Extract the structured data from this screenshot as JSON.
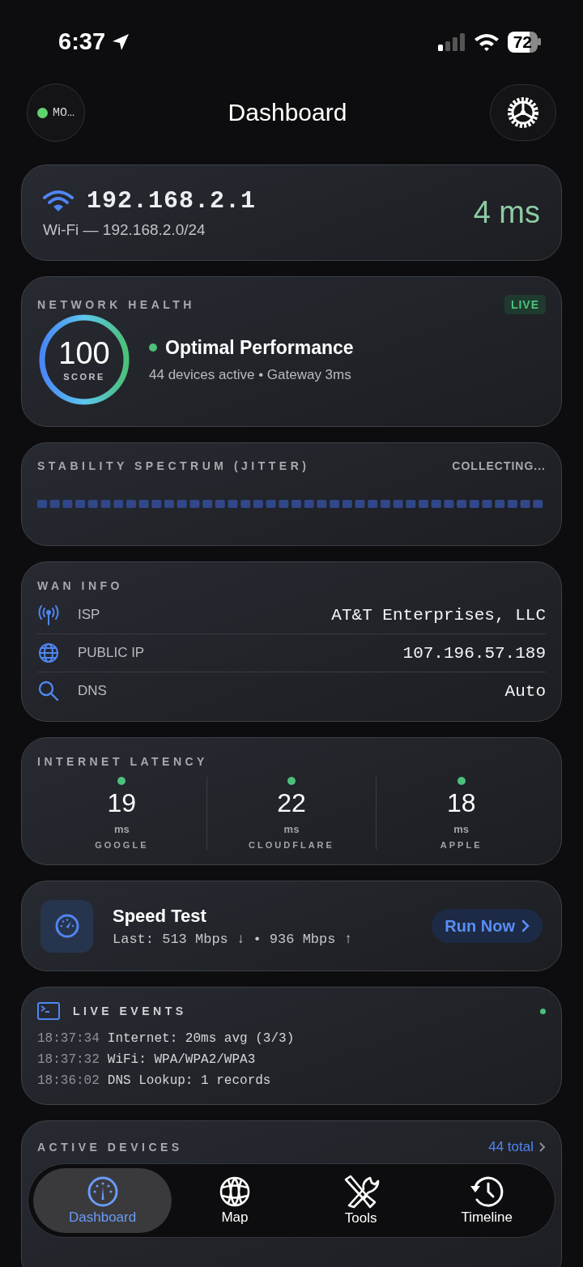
{
  "status_bar": {
    "time": "6:37",
    "battery": "72"
  },
  "header": {
    "mode_label": "MO…",
    "title": "Dashboard"
  },
  "connection": {
    "gateway": "192.168.2.1",
    "subtitle": "Wi-Fi — 192.168.2.0/24",
    "latency": "4 ms"
  },
  "network_health": {
    "title": "NETWORK HEALTH",
    "badge": "LIVE",
    "score": "100",
    "score_label": "SCORE",
    "level": 1,
    "status": "Optimal Performance",
    "detail": "44 devices active • Gateway 3ms"
  },
  "stability": {
    "title": "STABILITY SPECTRUM (JITTER)",
    "status": "COLLECTING..."
  },
  "wan_info": {
    "title": "WAN INFO",
    "rows": [
      {
        "kind": "antenna",
        "label": "ISP",
        "value": "AT&T Enterprises, LLC"
      },
      {
        "kind": "globe",
        "label": "PUBLIC IP",
        "value": "107.196.57.189"
      },
      {
        "kind": "search",
        "label": "DNS",
        "value": "Auto"
      }
    ]
  },
  "latency": {
    "title": "INTERNET LATENCY",
    "targets": [
      {
        "value": "19",
        "unit": "ms",
        "name": "GOOGLE"
      },
      {
        "value": "22",
        "unit": "ms",
        "name": "CLOUDFLARE"
      },
      {
        "value": "18",
        "unit": "ms",
        "name": "APPLE"
      }
    ]
  },
  "speed_test": {
    "title": "Speed Test",
    "last": "Last: 513 Mbps ↓ • 936 Mbps ↑",
    "button": "Run Now"
  },
  "live_events": {
    "title": "LIVE EVENTS",
    "events": [
      {
        "time": "18:37:34",
        "message": "Internet: 20ms avg (3/3)"
      },
      {
        "time": "18:37:32",
        "message": "WiFi: WPA/WPA2/WPA3"
      },
      {
        "time": "18:36:02",
        "message": "DNS Lookup: 1 records"
      }
    ]
  },
  "active_devices": {
    "title": "ACTIVE DEVICES",
    "link": "44 total"
  },
  "tabs": [
    {
      "kind": "gauge",
      "label": "Dashboard",
      "selected": true
    },
    {
      "kind": "globe",
      "label": "Map",
      "selected": false
    },
    {
      "kind": "tools",
      "label": "Tools",
      "selected": false
    },
    {
      "kind": "history",
      "label": "Timeline",
      "selected": false
    }
  ]
}
